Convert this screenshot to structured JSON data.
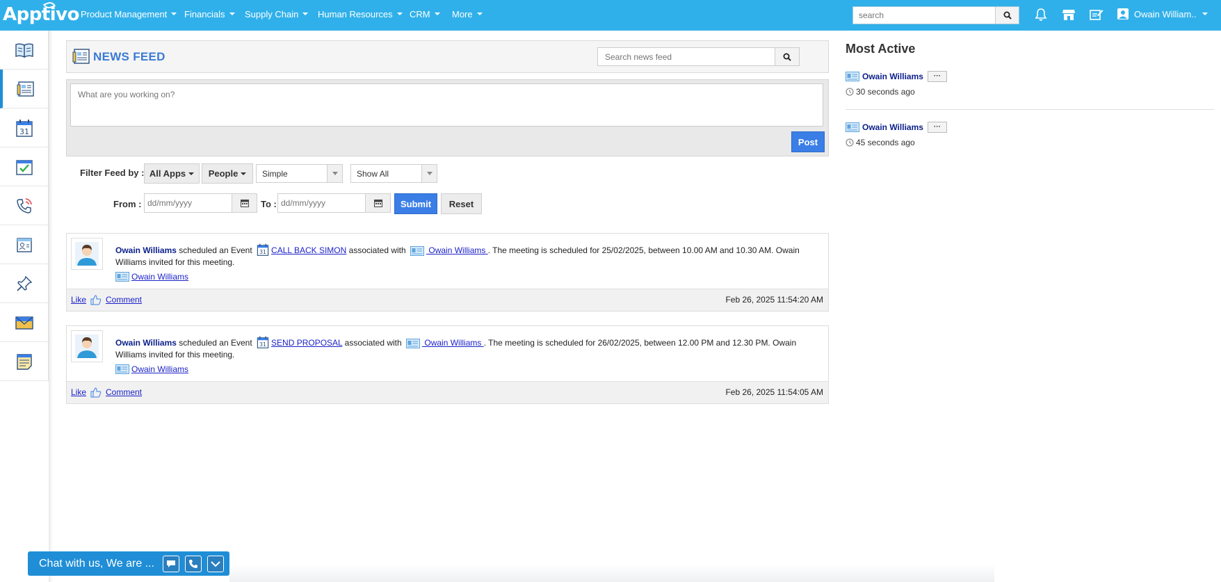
{
  "app": {
    "logo": "Apptivo"
  },
  "topnav": {
    "items": [
      {
        "label": "Product Management"
      },
      {
        "label": "Financials"
      },
      {
        "label": "Supply Chain"
      },
      {
        "label": "Human Resources"
      },
      {
        "label": "CRM"
      },
      {
        "label": "More"
      }
    ],
    "search_placeholder": "search",
    "user_name": "Owain William.."
  },
  "sidebar": {
    "items": [
      {
        "icon": "book-icon"
      },
      {
        "icon": "news-feed-icon",
        "active": true
      },
      {
        "icon": "calendar-icon"
      },
      {
        "icon": "task-check-icon"
      },
      {
        "icon": "phone-call-icon"
      },
      {
        "icon": "contact-card-icon"
      },
      {
        "icon": "pin-icon"
      },
      {
        "icon": "mail-icon"
      },
      {
        "icon": "notes-icon"
      }
    ]
  },
  "news_feed": {
    "title": "NEWS FEED",
    "search_placeholder": "Search news feed",
    "composer_placeholder": "What are you working on?",
    "post_label": "Post"
  },
  "filters": {
    "filter_label": "Filter Feed by :",
    "all_apps_label": "All Apps",
    "people_label": "People",
    "view_select": "Simple",
    "show_select": "Show All",
    "from_label": "From :",
    "to_label": "To :",
    "date_placeholder": "dd/mm/yyyy",
    "submit_label": "Submit",
    "reset_label": "Reset"
  },
  "posts": [
    {
      "author": "Owain Williams",
      "action": "scheduled an Event",
      "event": "CALL BACK SIMON",
      "assoc": "associated with",
      "contact": " Owain Williams ",
      "details": ". The meeting is scheduled for 25/02/2025, between 10.00 AM and 10.30 AM. Owain Williams invited for this meeting.",
      "tag": "Owain Williams",
      "like": "Like",
      "comment": "Comment",
      "time": "Feb 26, 2025 11:54:20 AM"
    },
    {
      "author": "Owain Williams",
      "action": "scheduled an Event",
      "event": "SEND PROPOSAL",
      "assoc": "associated with",
      "contact": " Owain Williams ",
      "details": ". The meeting is scheduled for 26/02/2025, between 12.00 PM and 12.30 PM. Owain Williams invited for this meeting.",
      "tag": "Owain Williams",
      "like": "Like",
      "comment": "Comment",
      "time": "Feb 26, 2025 11:54:05 AM"
    }
  ],
  "most_active": {
    "title": "Most Active",
    "more_label": "···",
    "items": [
      {
        "name": "Owain Williams",
        "ago": "30 seconds ago"
      },
      {
        "name": "Owain Williams",
        "ago": "45 seconds ago"
      }
    ]
  },
  "chat": {
    "label": "Chat with us, We are ..."
  },
  "colors": {
    "topbar": "#30b0ea",
    "primary_button": "#3a7ee6",
    "link": "#1c22c8",
    "author": "#0b1f8a"
  }
}
